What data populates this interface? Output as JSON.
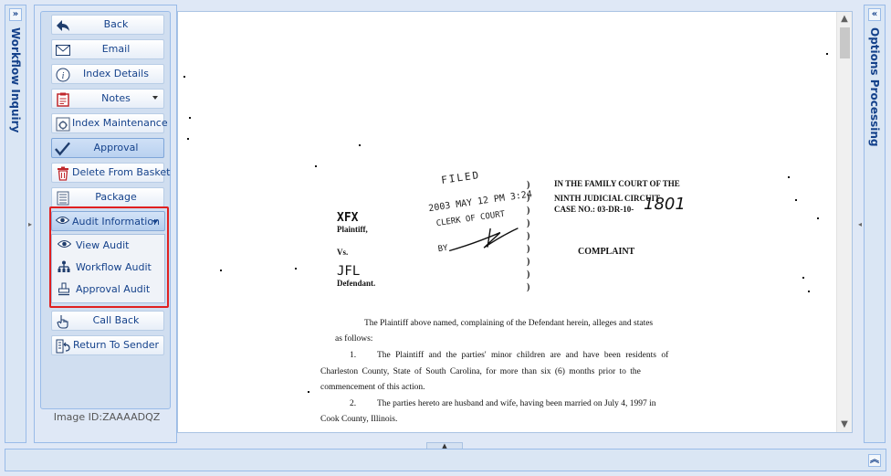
{
  "left_panel": {
    "title": "Workflow Inquiry",
    "expand_glyph": "»"
  },
  "right_panel": {
    "title": "Options Processing",
    "expand_glyph": "«"
  },
  "toolbar": {
    "buttons": [
      {
        "label": "Back",
        "icon": "back-arrow-icon"
      },
      {
        "label": "Email",
        "icon": "envelope-icon"
      },
      {
        "label": "Index Details",
        "icon": "info-icon"
      },
      {
        "label": "Notes",
        "icon": "notes-icon"
      },
      {
        "label": "Index Maintenance",
        "icon": "index-maintenance-icon"
      },
      {
        "label": "Approval",
        "icon": "checkmark-icon"
      },
      {
        "label": "Delete From Basket",
        "icon": "trash-icon"
      },
      {
        "label": "Package",
        "icon": "package-icon"
      },
      {
        "label": "Call Back",
        "icon": "hand-pointer-icon"
      },
      {
        "label": "Return To Sender",
        "icon": "return-icon"
      }
    ],
    "audit": {
      "label": "Audit Information",
      "items": [
        {
          "label": "View Audit",
          "icon": "eye-icon"
        },
        {
          "label": "Workflow Audit",
          "icon": "hierarchy-icon"
        },
        {
          "label": "Approval Audit",
          "icon": "stamp-icon"
        }
      ]
    },
    "image_id": "Image ID:ZAAAADQZ"
  },
  "document": {
    "court_line1": "IN THE FAMILY COURT OF THE",
    "court_line2": "NINTH JUDICIAL CIRCUIT",
    "case_no": "CASE NO.: 03-DR-10-",
    "case_no_hand": "1801",
    "plaintiff_name": "XFX",
    "plaintiff_label": "Plaintiff,",
    "vs": "Vs.",
    "defendant_name": "JFL",
    "defendant_label": "Defendant.",
    "complaint": "COMPLAINT",
    "stamp_line1": "FILED",
    "stamp_line2": "2003 MAY 12  PM 3:24",
    "stamp_line3": "CLERK OF COURT",
    "stamp_line4": "BY",
    "para_intro": "The Plaintiff above named, complaining of the Defendant herein, alleges and states",
    "para_intro2": "as follows:",
    "p1_num": "1.",
    "p1_line1": "The Plaintiff and the parties' minor children are and have been residents of",
    "p1_line2": "Charleston County, State of South Carolina, for more than six (6) months prior to the",
    "p1_line3": "commencement of this action.",
    "p2_num": "2.",
    "p2_line1": "The parties hereto are husband and wife, having been married on July 4, 1997 in",
    "p2_line2": "Cook County, Illinois."
  }
}
